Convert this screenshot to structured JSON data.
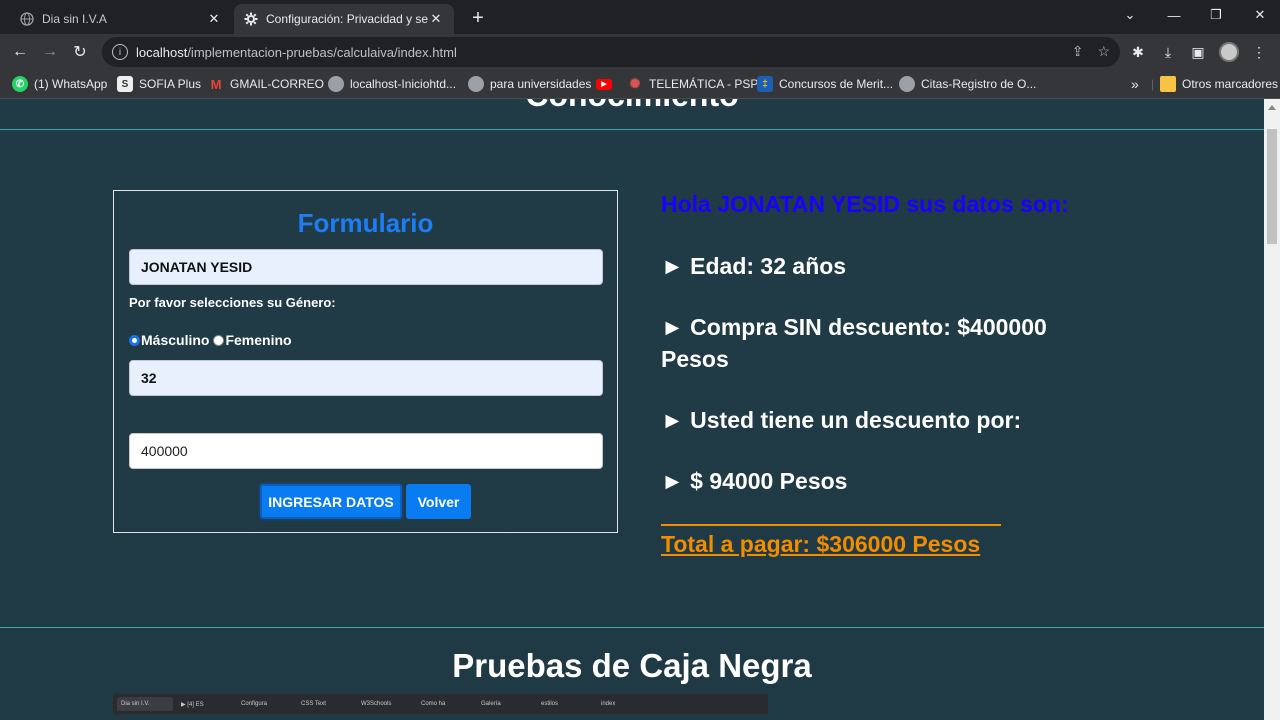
{
  "browser": {
    "tabs": [
      {
        "title": "Dia sin I.V.A",
        "active": false,
        "icon": "globe-icon"
      },
      {
        "title": "Configuración: Privacidad y segu",
        "active": true,
        "icon": "gear-icon"
      }
    ],
    "new_tab_symbol": "+",
    "window_controls": {
      "dropdown": "⌄",
      "minimize": "—",
      "restore": "❐",
      "close": "✕"
    },
    "url": {
      "host": "localhost",
      "path": "/implementacion-pruebas/calculaiva/index.html"
    },
    "bookmarks": [
      {
        "label": "(1) WhatsApp",
        "icon": "whatsapp-icon",
        "color": "#25d366"
      },
      {
        "label": "SOFIA Plus",
        "icon": "sofia-icon",
        "color": "#eeeeee"
      },
      {
        "label": "GMAIL-CORREO",
        "icon": "gmail-icon",
        "color": "#ea4335"
      },
      {
        "label": "localhost-Iniciohtd...",
        "icon": "globe-icon",
        "color": "#9aa0a6"
      },
      {
        "label": "para universidades",
        "icon": "globe-icon",
        "color": "#9aa0a6"
      },
      {
        "label": "",
        "icon": "youtube-icon",
        "color": "#ff0000"
      },
      {
        "label": "TELEMÁTICA - PSP",
        "icon": "telematica-icon",
        "color": "#b03a2e"
      },
      {
        "label": "Concursos de Merit...",
        "icon": "concursos-icon",
        "color": "#1a5fb4"
      },
      {
        "label": "Citas-Registro de O...",
        "icon": "globe-icon",
        "color": "#9aa0a6"
      }
    ],
    "bookmarks_overflow": "»",
    "other_bookmarks": "Otros marcadores"
  },
  "page": {
    "form": {
      "title": "Formulario",
      "name_value": "JONATAN YESID",
      "gender_prompt": "Por favor selecciones su Género:",
      "gender_options": [
        {
          "label": "Másculino",
          "checked": true
        },
        {
          "label": "Femenino",
          "checked": false
        }
      ],
      "age_value": "32",
      "amount_value": "400000",
      "submit_label": "INGRESAR DATOS",
      "back_label": "Volver"
    },
    "results": {
      "greeting": "Hola JONATAN YESID sus datos son:",
      "age_line": "► Edad: 32 años",
      "purchase_line": "► Compra SIN descuento: $400000 Pesos",
      "discount_line": "► Usted tiene un descuento por:",
      "discount_amount_line": "► $ 94000 Pesos",
      "total_line": "Total a pagar: $306000 Pesos"
    },
    "section_title": "Pruebas de Caja Negra"
  },
  "mini_strip": {
    "tabs": [
      "Dia sin I.V.",
      "▶ [4] ES",
      "Configura",
      "CSS Text",
      "W3Schools",
      "Como ha",
      "Galería",
      "estilos",
      "index"
    ]
  },
  "colors": {
    "accent_blue": "#1e7df2",
    "greeting_blue": "#1900ff",
    "total_orange": "#f28c00",
    "page_bg": "#1f3a45"
  }
}
